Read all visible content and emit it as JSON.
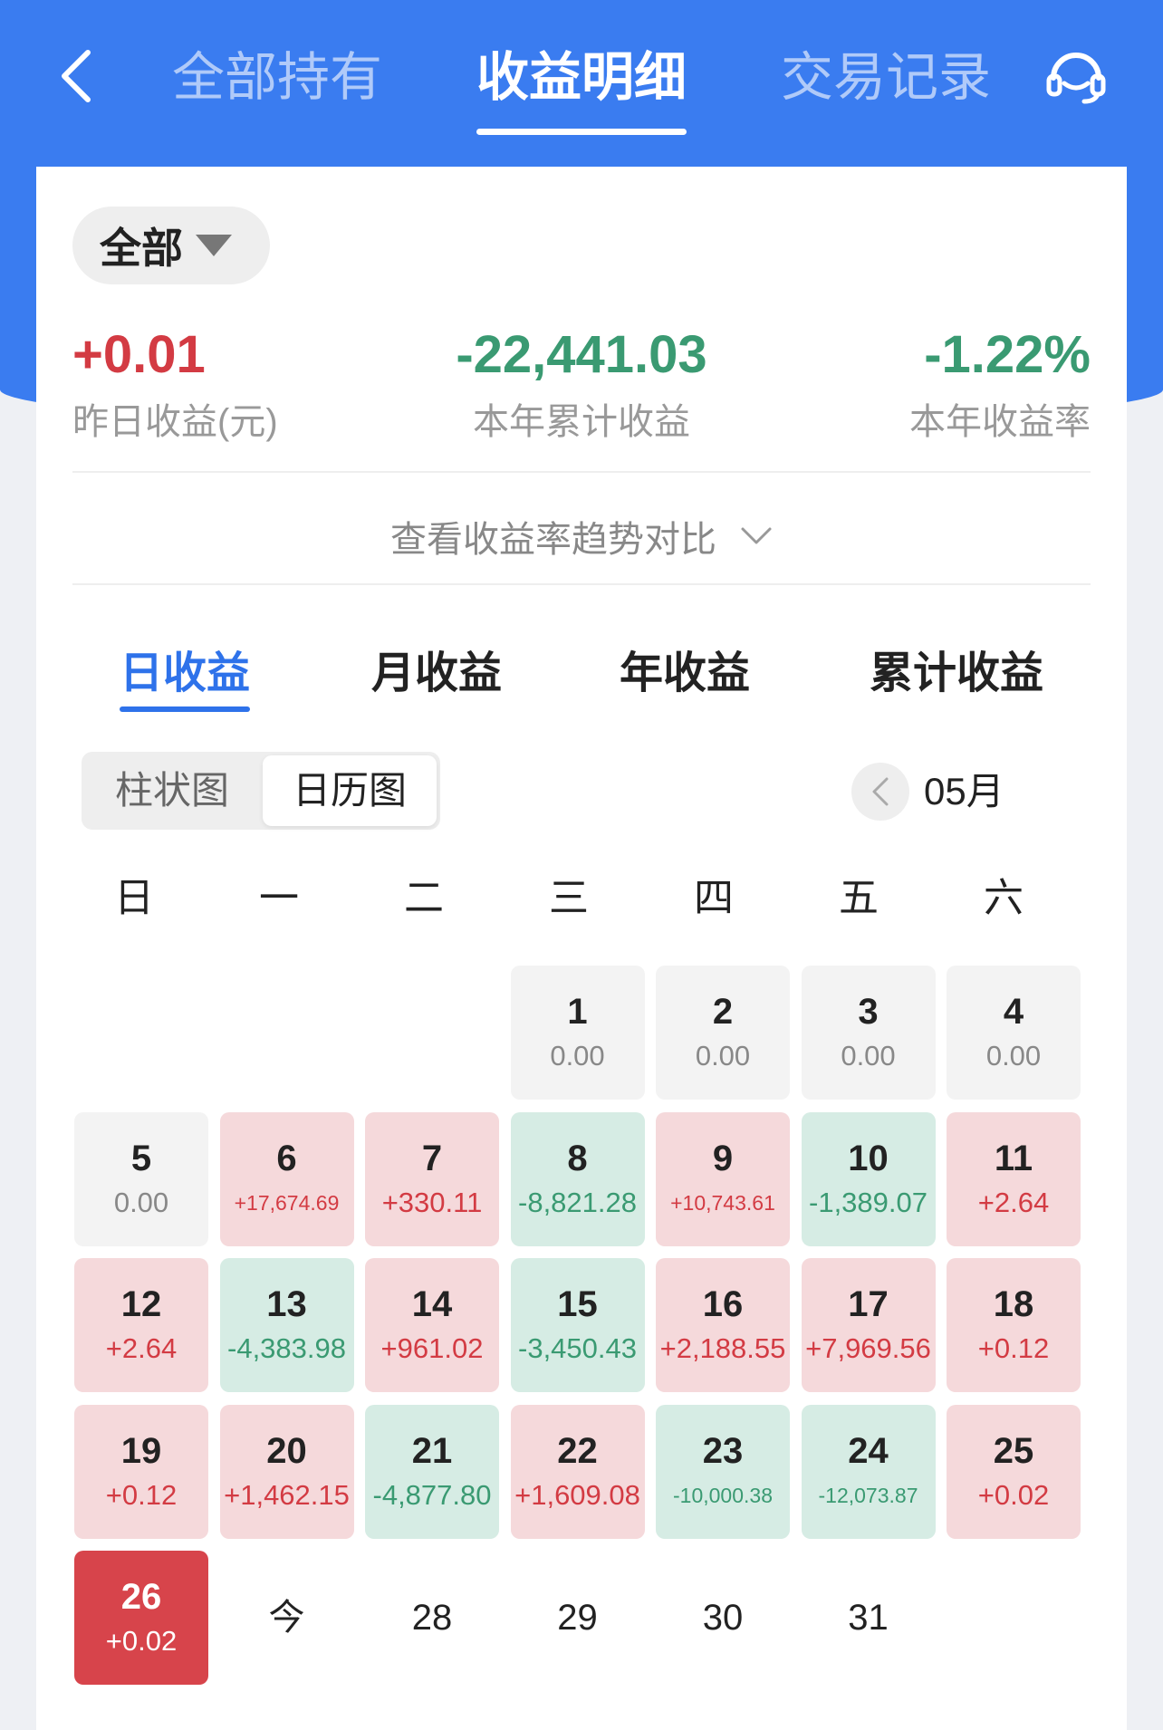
{
  "top_tabs": [
    "全部持有",
    "收益明细",
    "交易记录"
  ],
  "filter": {
    "label": "全部"
  },
  "stats": [
    {
      "value": "+0.01",
      "label": "昨日收益(元)"
    },
    {
      "value": "-22,441.03",
      "label": "本年累计收益"
    },
    {
      "value": "-1.22%",
      "label": "本年收益率"
    }
  ],
  "trend_link": "查看收益率趋势对比",
  "profit_tabs": [
    "日收益",
    "月收益",
    "年收益",
    "累计收益"
  ],
  "view_toggle": [
    "柱状图",
    "日历图"
  ],
  "month": "05月",
  "weekdays": [
    "日",
    "一",
    "二",
    "三",
    "四",
    "五",
    "六"
  ],
  "calendar": [
    {
      "day": "1",
      "amount": "0.00"
    },
    {
      "day": "2",
      "amount": "0.00"
    },
    {
      "day": "3",
      "amount": "0.00"
    },
    {
      "day": "4",
      "amount": "0.00"
    },
    {
      "day": "5",
      "amount": "0.00"
    },
    {
      "day": "6",
      "amount": "+17,674.69"
    },
    {
      "day": "7",
      "amount": "+330.11"
    },
    {
      "day": "8",
      "amount": "-8,821.28"
    },
    {
      "day": "9",
      "amount": "+10,743.61"
    },
    {
      "day": "10",
      "amount": "-1,389.07"
    },
    {
      "day": "11",
      "amount": "+2.64"
    },
    {
      "day": "12",
      "amount": "+2.64"
    },
    {
      "day": "13",
      "amount": "-4,383.98"
    },
    {
      "day": "14",
      "amount": "+961.02"
    },
    {
      "day": "15",
      "amount": "-3,450.43"
    },
    {
      "day": "16",
      "amount": "+2,188.55"
    },
    {
      "day": "17",
      "amount": "+7,969.56"
    },
    {
      "day": "18",
      "amount": "+0.12"
    },
    {
      "day": "19",
      "amount": "+0.12"
    },
    {
      "day": "20",
      "amount": "+1,462.15"
    },
    {
      "day": "21",
      "amount": "-4,877.80"
    },
    {
      "day": "22",
      "amount": "+1,609.08"
    },
    {
      "day": "23",
      "amount": "-10,000.38"
    },
    {
      "day": "24",
      "amount": "-12,073.87"
    },
    {
      "day": "25",
      "amount": "+0.02"
    },
    {
      "day": "26",
      "amount": "+0.02"
    },
    {
      "day": "今",
      "amount": ""
    },
    {
      "day": "28",
      "amount": ""
    },
    {
      "day": "29",
      "amount": ""
    },
    {
      "day": "30",
      "amount": ""
    },
    {
      "day": "31",
      "amount": ""
    }
  ]
}
